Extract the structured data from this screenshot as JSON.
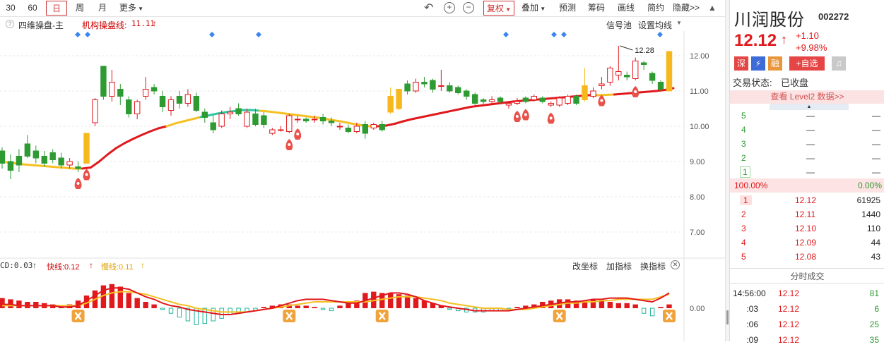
{
  "toolbar": {
    "periods": [
      "30",
      "60",
      "日",
      "周",
      "月",
      "更多"
    ],
    "active_period": "日",
    "fuquan": "复权",
    "overlay": "叠加",
    "predict": "预测",
    "chips": "筹码",
    "draw": "画线",
    "simple": "简约",
    "hide": "隐藏>>"
  },
  "legend": {
    "indicator": "四维操盘-主",
    "inst_line_label": "机构操盘线:",
    "inst_line_value": "11.11",
    "signal_pool": "信号池",
    "set_ma": "设置均线"
  },
  "sub_legend": {
    "macd_label": "CD:0.03",
    "fast_label": "快线:0.12",
    "slow_label": "慢线:0.11",
    "change_coord": "改坐标",
    "add_indicator": "加指标",
    "switch_indicator": "换指标"
  },
  "colors": {
    "up": "#e0191d",
    "down": "#2e9a32",
    "limit_up": "#f7b81d",
    "line_red": "#e0191d",
    "line_yellow": "#f5c023",
    "line_teal": "#2ec6a0",
    "accent": "#c33"
  },
  "chart_data": [
    {
      "type": "candlestick",
      "title": "四维操盘-主",
      "y_ticks": [
        "12.00",
        "11.00",
        "10.00",
        "9.00",
        "8.00",
        "7.00"
      ],
      "ylim": [
        6.3,
        12.6
      ],
      "annotation": "12.28",
      "candles": [
        {
          "o": 9.3,
          "c": 8.95,
          "h": 9.4,
          "l": 8.8
        },
        {
          "o": 9.0,
          "c": 8.75,
          "h": 9.2,
          "l": 8.5
        },
        {
          "o": 9.15,
          "c": 8.9,
          "h": 9.35,
          "l": 8.7
        },
        {
          "o": 9.5,
          "c": 9.15,
          "h": 9.75,
          "l": 9.1
        },
        {
          "o": 9.3,
          "c": 9.1,
          "h": 9.45,
          "l": 8.95
        },
        {
          "o": 9.15,
          "c": 8.95,
          "h": 9.3,
          "l": 8.85
        },
        {
          "o": 9.25,
          "c": 9.05,
          "h": 9.35,
          "l": 8.95
        },
        {
          "o": 9.1,
          "c": 8.9,
          "h": 9.25,
          "l": 8.8
        },
        {
          "o": 8.9,
          "c": 9.0,
          "h": 9.1,
          "l": 8.8
        },
        {
          "o": 8.85,
          "c": 8.8,
          "h": 9.0,
          "l": 8.7
        },
        {
          "o": 8.95,
          "c": 9.8,
          "h": 9.8,
          "l": 8.95,
          "limit": true
        },
        {
          "o": 10.1,
          "c": 10.75,
          "h": 10.8,
          "l": 10.0
        },
        {
          "o": 11.7,
          "c": 10.85,
          "h": 11.7,
          "l": 10.75
        },
        {
          "o": 10.85,
          "c": 11.25,
          "h": 11.6,
          "l": 10.7
        },
        {
          "o": 11.05,
          "c": 10.85,
          "h": 11.2,
          "l": 10.6
        },
        {
          "o": 10.75,
          "c": 10.35,
          "h": 10.85,
          "l": 10.25
        },
        {
          "o": 10.35,
          "c": 10.7,
          "h": 10.75,
          "l": 10.2
        },
        {
          "o": 10.85,
          "c": 11.05,
          "h": 11.4,
          "l": 10.75
        },
        {
          "o": 11.1,
          "c": 11.0,
          "h": 11.2,
          "l": 10.9
        },
        {
          "o": 10.85,
          "c": 10.55,
          "h": 11.0,
          "l": 10.4
        },
        {
          "o": 10.45,
          "c": 10.75,
          "h": 10.85,
          "l": 10.3
        },
        {
          "o": 10.85,
          "c": 10.65,
          "h": 11.0,
          "l": 10.5
        },
        {
          "o": 10.65,
          "c": 10.9,
          "h": 11.05,
          "l": 10.55
        },
        {
          "o": 10.85,
          "c": 10.45,
          "h": 10.95,
          "l": 10.4
        },
        {
          "o": 10.4,
          "c": 10.25,
          "h": 10.5,
          "l": 10.1
        },
        {
          "o": 10.1,
          "c": 9.9,
          "h": 10.3,
          "l": 9.8
        },
        {
          "o": 10.0,
          "c": 10.35,
          "h": 10.45,
          "l": 9.95
        },
        {
          "o": 10.35,
          "c": 10.4,
          "h": 10.55,
          "l": 10.2
        },
        {
          "o": 10.5,
          "c": 10.35,
          "h": 10.65,
          "l": 10.3
        },
        {
          "o": 10.0,
          "c": 10.4,
          "h": 10.5,
          "l": 9.95
        },
        {
          "o": 10.35,
          "c": 10.05,
          "h": 10.5,
          "l": 10.0
        },
        {
          "o": 10.3,
          "c": 10.05,
          "h": 10.4,
          "l": 9.95
        },
        {
          "o": 9.8,
          "c": 9.9,
          "h": 9.95,
          "l": 9.75
        },
        {
          "o": 9.9,
          "c": 9.9,
          "h": 10.0,
          "l": 9.85
        },
        {
          "o": 9.85,
          "c": 10.3,
          "h": 10.35,
          "l": 9.8
        },
        {
          "o": 10.2,
          "c": 10.2,
          "h": 10.3,
          "l": 10.1
        },
        {
          "o": 10.2,
          "c": 10.15,
          "h": 10.25,
          "l": 10.1
        },
        {
          "o": 10.2,
          "c": 10.2,
          "h": 10.3,
          "l": 10.1
        },
        {
          "o": 10.25,
          "c": 10.15,
          "h": 10.35,
          "l": 10.05
        },
        {
          "o": 10.15,
          "c": 10.1,
          "h": 10.25,
          "l": 10.0
        },
        {
          "o": 10.0,
          "c": 10.0,
          "h": 10.1,
          "l": 9.9
        },
        {
          "o": 9.95,
          "c": 9.85,
          "h": 10.05,
          "l": 9.8
        },
        {
          "o": 9.85,
          "c": 10.0,
          "h": 10.1,
          "l": 9.8
        },
        {
          "o": 10.05,
          "c": 9.8,
          "h": 10.15,
          "l": 9.65
        },
        {
          "o": 9.95,
          "c": 10.05,
          "h": 10.1,
          "l": 9.9
        },
        {
          "o": 10.05,
          "c": 9.9,
          "h": 10.15,
          "l": 9.85
        },
        {
          "o": 10.4,
          "c": 10.85,
          "h": 11.1,
          "l": 10.35,
          "limit": true
        },
        {
          "o": 10.5,
          "c": 11.05,
          "h": 11.05,
          "l": 10.45,
          "limit": true
        },
        {
          "o": 11.2,
          "c": 11.0,
          "h": 11.3,
          "l": 10.9
        },
        {
          "o": 11.0,
          "c": 11.25,
          "h": 11.35,
          "l": 10.95
        },
        {
          "o": 11.25,
          "c": 11.2,
          "h": 11.4,
          "l": 11.1
        },
        {
          "o": 11.3,
          "c": 11.05,
          "h": 11.35,
          "l": 10.95
        },
        {
          "o": 11.15,
          "c": 11.15,
          "h": 11.6,
          "l": 11.0
        },
        {
          "o": 11.15,
          "c": 11.0,
          "h": 11.25,
          "l": 10.95
        },
        {
          "o": 11.1,
          "c": 10.95,
          "h": 11.15,
          "l": 10.9
        },
        {
          "o": 11.0,
          "c": 10.85,
          "h": 11.05,
          "l": 10.75
        },
        {
          "o": 10.9,
          "c": 10.65,
          "h": 10.95,
          "l": 10.6
        },
        {
          "o": 10.75,
          "c": 10.7,
          "h": 10.8,
          "l": 10.6
        },
        {
          "o": 10.7,
          "c": 10.75,
          "h": 10.85,
          "l": 10.65
        },
        {
          "o": 10.8,
          "c": 10.7,
          "h": 10.85,
          "l": 10.65
        },
        {
          "o": 10.6,
          "c": 10.65,
          "h": 10.7,
          "l": 10.5
        },
        {
          "o": 10.65,
          "c": 10.7,
          "h": 10.8,
          "l": 10.6
        },
        {
          "o": 10.8,
          "c": 10.7,
          "h": 10.85,
          "l": 10.65
        },
        {
          "o": 10.75,
          "c": 10.85,
          "h": 10.9,
          "l": 10.7
        },
        {
          "o": 10.8,
          "c": 10.7,
          "h": 10.85,
          "l": 10.65
        },
        {
          "o": 10.6,
          "c": 10.65,
          "h": 10.7,
          "l": 10.55
        },
        {
          "o": 10.6,
          "c": 10.8,
          "h": 10.85,
          "l": 10.55
        },
        {
          "o": 10.65,
          "c": 10.85,
          "h": 10.9,
          "l": 10.6
        },
        {
          "o": 10.85,
          "c": 10.65,
          "h": 10.9,
          "l": 10.6
        },
        {
          "o": 10.75,
          "c": 11.15,
          "h": 11.65,
          "l": 10.7,
          "limit": true
        },
        {
          "o": 10.85,
          "c": 11.0,
          "h": 11.1,
          "l": 10.8
        },
        {
          "o": 11.15,
          "c": 11.2,
          "h": 11.4,
          "l": 11.05
        },
        {
          "o": 11.25,
          "c": 11.65,
          "h": 11.7,
          "l": 11.15
        },
        {
          "o": 11.45,
          "c": 11.55,
          "h": 12.28,
          "l": 11.3
        },
        {
          "o": 11.45,
          "c": 11.4,
          "h": 11.55,
          "l": 11.3
        },
        {
          "o": 11.35,
          "c": 11.85,
          "h": 11.95,
          "l": 11.3
        },
        {
          "o": 11.8,
          "c": 11.75,
          "h": 11.85,
          "l": 11.6
        },
        {
          "o": 11.5,
          "c": 11.3,
          "h": 11.55,
          "l": 11.2
        },
        {
          "o": 11.25,
          "c": 11.05,
          "h": 11.3,
          "l": 11.0
        },
        {
          "o": 11.0,
          "c": 12.12,
          "h": 12.12,
          "l": 11.0,
          "limit": true
        }
      ],
      "ma_line": [
        8.98,
        8.95,
        8.92,
        8.9,
        8.88,
        8.86,
        8.84,
        8.82,
        8.8,
        8.8,
        8.83,
        9.0,
        9.2,
        9.38,
        9.52,
        9.64,
        9.75,
        9.85,
        9.94,
        10.0,
        10.08,
        10.14,
        10.2,
        10.26,
        10.31,
        10.36,
        10.4,
        10.43,
        10.46,
        10.46,
        10.44,
        10.42,
        10.39,
        10.36,
        10.33,
        10.3,
        10.27,
        10.24,
        10.2,
        10.16,
        10.12,
        10.07,
        10.03,
        10.0,
        10.0,
        10.02,
        10.07,
        10.14,
        10.2,
        10.25,
        10.3,
        10.35,
        10.4,
        10.45,
        10.5,
        10.55,
        10.58,
        10.61,
        10.64,
        10.67,
        10.7,
        10.72,
        10.74,
        10.76,
        10.78,
        10.8,
        10.82,
        10.84,
        10.86,
        10.88,
        10.88,
        10.89,
        10.9,
        10.92,
        10.94,
        10.96,
        10.98,
        11.0,
        11.03,
        11.08
      ],
      "signal_markers": [
        9,
        10,
        34,
        35,
        61,
        62,
        65,
        71,
        75
      ]
    },
    {
      "type": "bar",
      "title": "MACD",
      "y_ticks": [
        "0.00"
      ],
      "histogram": [
        0.08,
        0.07,
        0.06,
        0.05,
        0.05,
        0.04,
        0.03,
        0.02,
        0.03,
        0.06,
        0.1,
        0.14,
        0.18,
        0.19,
        0.17,
        0.12,
        0.08,
        0.05,
        0.03,
        -0.01,
        -0.04,
        -0.07,
        -0.1,
        -0.13,
        -0.12,
        -0.1,
        -0.08,
        -0.05,
        -0.04,
        -0.03,
        -0.02,
        0.01,
        0.02,
        0.03,
        0.03,
        0.02,
        0.02,
        0.01,
        -0.01,
        -0.02,
        0.02,
        0.04,
        0.06,
        0.12,
        0.13,
        0.12,
        0.12,
        0.11,
        0.1,
        0.08,
        0.06,
        0.04,
        0.02,
        -0.01,
        -0.02,
        -0.03,
        -0.03,
        -0.03,
        -0.02,
        -0.02,
        -0.01,
        0.01,
        0.02,
        0.03,
        0.05,
        0.06,
        0.07,
        0.07,
        0.06,
        0.06,
        0.07,
        0.06,
        0.05,
        0.04,
        0.04,
        0.03,
        -0.04,
        -0.06,
        0.01,
        0.03
      ],
      "fast_line": [
        0.03,
        0.03,
        0.02,
        0.02,
        0.02,
        0.02,
        0.02,
        0.01,
        0.01,
        0.02,
        0.06,
        0.1,
        0.14,
        0.16,
        0.16,
        0.15,
        0.12,
        0.09,
        0.07,
        0.04,
        0.02,
        0.01,
        -0.01,
        -0.02,
        -0.03,
        -0.04,
        -0.05,
        -0.05,
        -0.04,
        -0.03,
        -0.02,
        -0.01,
        0.0,
        0.02,
        0.04,
        0.06,
        0.07,
        0.07,
        0.07,
        0.06,
        0.05,
        0.04,
        0.04,
        0.06,
        0.08,
        0.1,
        0.12,
        0.12,
        0.11,
        0.09,
        0.06,
        0.04,
        0.02,
        0.01,
        0.0,
        -0.01,
        -0.02,
        -0.02,
        -0.02,
        -0.02,
        -0.02,
        -0.01,
        0.0,
        0.01,
        0.02,
        0.03,
        0.04,
        0.05,
        0.05,
        0.06,
        0.07,
        0.07,
        0.08,
        0.08,
        0.08,
        0.07,
        0.06,
        0.05,
        0.08,
        0.12
      ],
      "slow_line": [
        0.02,
        0.02,
        0.02,
        0.02,
        0.02,
        0.02,
        0.02,
        0.02,
        0.02,
        0.02,
        0.04,
        0.07,
        0.1,
        0.12,
        0.13,
        0.13,
        0.12,
        0.11,
        0.09,
        0.07,
        0.05,
        0.03,
        0.02,
        0.0,
        -0.01,
        -0.02,
        -0.03,
        -0.03,
        -0.03,
        -0.03,
        -0.02,
        -0.01,
        0.0,
        0.01,
        0.02,
        0.03,
        0.04,
        0.05,
        0.05,
        0.05,
        0.05,
        0.05,
        0.05,
        0.05,
        0.06,
        0.07,
        0.08,
        0.09,
        0.09,
        0.09,
        0.08,
        0.07,
        0.06,
        0.04,
        0.03,
        0.02,
        0.01,
        0.0,
        0.0,
        0.0,
        -0.01,
        -0.01,
        -0.01,
        0.0,
        0.01,
        0.02,
        0.03,
        0.04,
        0.04,
        0.05,
        0.05,
        0.06,
        0.06,
        0.07,
        0.07,
        0.07,
        0.07,
        0.07,
        0.09,
        0.11
      ],
      "cross_markers": [
        9,
        34,
        45,
        66,
        79
      ]
    }
  ],
  "stock": {
    "name": "川润股份",
    "code": "002272",
    "price": "12.12",
    "arrow": "↑",
    "change": "+1.10",
    "change_pct": "+9.98%",
    "badges": [
      "深",
      "⚡",
      "融",
      "+自选"
    ],
    "status_label": "交易状态:",
    "status_value": "已收盘",
    "level2": "查看 Level2 数据>>"
  },
  "order_book": {
    "sell": [
      {
        "level": "5",
        "price": "—",
        "vol": "—"
      },
      {
        "level": "4",
        "price": "—",
        "vol": "—"
      },
      {
        "level": "3",
        "price": "—",
        "vol": "—"
      },
      {
        "level": "2",
        "price": "—",
        "vol": "—"
      },
      {
        "level": "1",
        "price": "—",
        "vol": "—"
      }
    ],
    "ratio_left": "100.00%",
    "ratio_right": "0.00%",
    "buy": [
      {
        "level": "1",
        "price": "12.12",
        "vol": "61925"
      },
      {
        "level": "2",
        "price": "12.11",
        "vol": "1440"
      },
      {
        "level": "3",
        "price": "12.10",
        "vol": "110"
      },
      {
        "level": "4",
        "price": "12.09",
        "vol": "44"
      },
      {
        "level": "5",
        "price": "12.08",
        "vol": "43"
      }
    ]
  },
  "ticks": {
    "title": "分时成交",
    "rows": [
      {
        "time": "14:56:00",
        "price": "12.12",
        "vol": "81"
      },
      {
        "time": ":03",
        "price": "12.12",
        "vol": "6"
      },
      {
        "time": ":06",
        "price": "12.12",
        "vol": "25"
      },
      {
        "time": ":09",
        "price": "12.12",
        "vol": "35"
      }
    ]
  }
}
